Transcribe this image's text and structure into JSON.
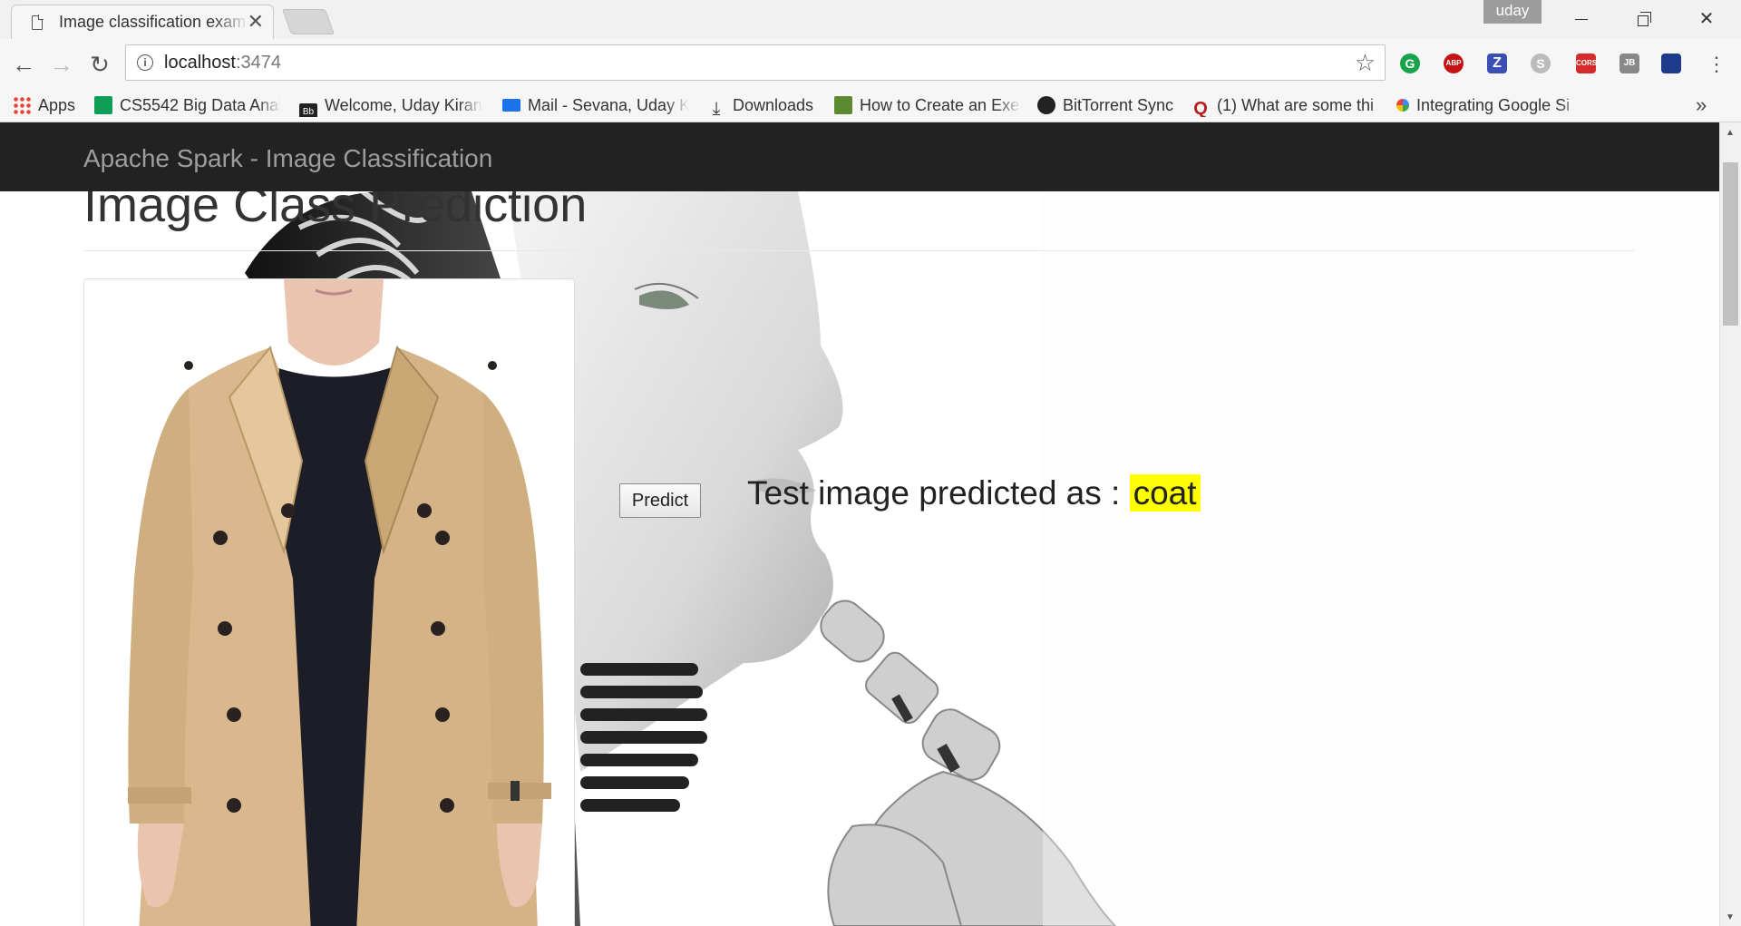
{
  "browser": {
    "tab_title": "Image classification exam",
    "tab_close": "✕",
    "profile_name": "uday",
    "address": {
      "host": "localhost",
      "port": ":3474"
    },
    "bookmarks": [
      {
        "label": "Apps"
      },
      {
        "label": "CS5542 Big Data Anal"
      },
      {
        "label": "Welcome, Uday Kiran"
      },
      {
        "label": "Mail - Sevana, Uday K"
      },
      {
        "label": "Downloads"
      },
      {
        "label": "How to Create an Exe"
      },
      {
        "label": "BitTorrent Sync"
      },
      {
        "label": "(1) What are some thi"
      },
      {
        "label": "Integrating Google Si"
      }
    ],
    "bookmarks_overflow": "»",
    "extensions": [
      {
        "name": "grammarly-icon",
        "text": "G"
      },
      {
        "name": "adblock-plus-icon",
        "text": "ABP"
      },
      {
        "name": "zotero-icon",
        "text": "Z"
      },
      {
        "name": "skype-icon",
        "text": "S"
      },
      {
        "name": "cors-icon",
        "text": "CORS"
      },
      {
        "name": "jetbrains-icon",
        "text": "JB"
      },
      {
        "name": "flag-extension-icon",
        "text": ""
      }
    ]
  },
  "page": {
    "brand": "Apache Spark - Image Classification",
    "title": "Image Class Prediction",
    "predict_button": "Predict",
    "result_prefix": "Test image predicted as : ",
    "result_label": "coat",
    "highlight_color": "#ffff00",
    "navbar_color": "#222222"
  }
}
